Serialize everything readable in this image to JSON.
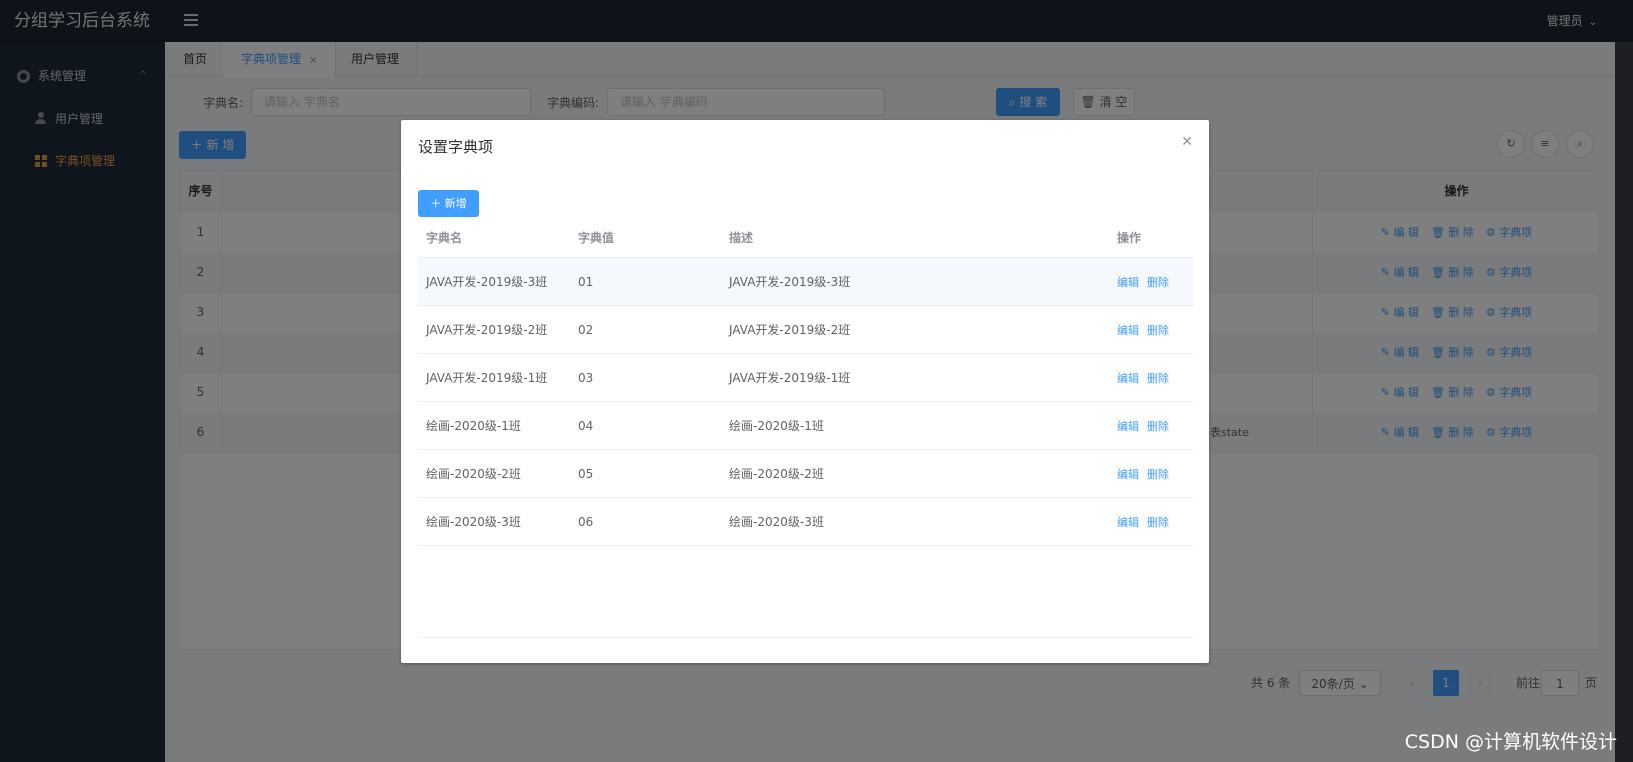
{
  "header": {
    "brand": "分组学习后台系统",
    "user": "管理员"
  },
  "sidebar": {
    "group": "系统管理",
    "items": [
      {
        "label": "用户管理"
      },
      {
        "label": "字典项管理"
      }
    ]
  },
  "tabs": [
    {
      "label": "首页"
    },
    {
      "label": "字典项管理"
    },
    {
      "label": "用户管理"
    }
  ],
  "search": {
    "name_label": "字典名:",
    "name_placeholder": "请输入 字典名",
    "code_label": "字典编码:",
    "code_placeholder": "请输入 字典编码",
    "search_btn": "搜 索",
    "clear_btn": "清 空"
  },
  "toolbar": {
    "add_btn": "新 增"
  },
  "bg_table": {
    "col_index": "序号",
    "col_op": "操作",
    "rows": [
      {
        "index": "1"
      },
      {
        "index": "2"
      },
      {
        "index": "3"
      },
      {
        "index": "4"
      },
      {
        "index": "5"
      },
      {
        "index": "6",
        "desc": "联码表state"
      }
    ],
    "op_edit": "编 辑",
    "op_delete": "删 除",
    "op_items": "字典项"
  },
  "pager": {
    "total": "共 6 条",
    "page_size": "20条/页",
    "current": "1",
    "goto_label": "前往",
    "goto_value": "1",
    "goto_unit": "页"
  },
  "dialog": {
    "title": "设置字典项",
    "add_btn": "新增",
    "columns": [
      "字典名",
      "字典值",
      "描述",
      "操作"
    ],
    "rows": [
      {
        "name": "JAVA开发-2019级-3班",
        "value": "01",
        "desc": "JAVA开发-2019级-3班"
      },
      {
        "name": "JAVA开发-2019级-2班",
        "value": "02",
        "desc": "JAVA开发-2019级-2班"
      },
      {
        "name": "JAVA开发-2019级-1班",
        "value": "03",
        "desc": "JAVA开发-2019级-1班"
      },
      {
        "name": "绘画-2020级-1班",
        "value": "04",
        "desc": "绘画-2020级-1班"
      },
      {
        "name": "绘画-2020级-2班",
        "value": "05",
        "desc": "绘画-2020级-2班"
      },
      {
        "name": "绘画-2020级-3班",
        "value": "06",
        "desc": "绘画-2020级-3班"
      }
    ],
    "op_edit": "编辑",
    "op_delete": "删除"
  },
  "watermark": "CSDN @计算机软件设计",
  "colors": {
    "primary": "#409eff",
    "header_bg": "#1d2533",
    "sidebar_bg": "#1f2a38",
    "active_menu": "#e6a23c"
  }
}
